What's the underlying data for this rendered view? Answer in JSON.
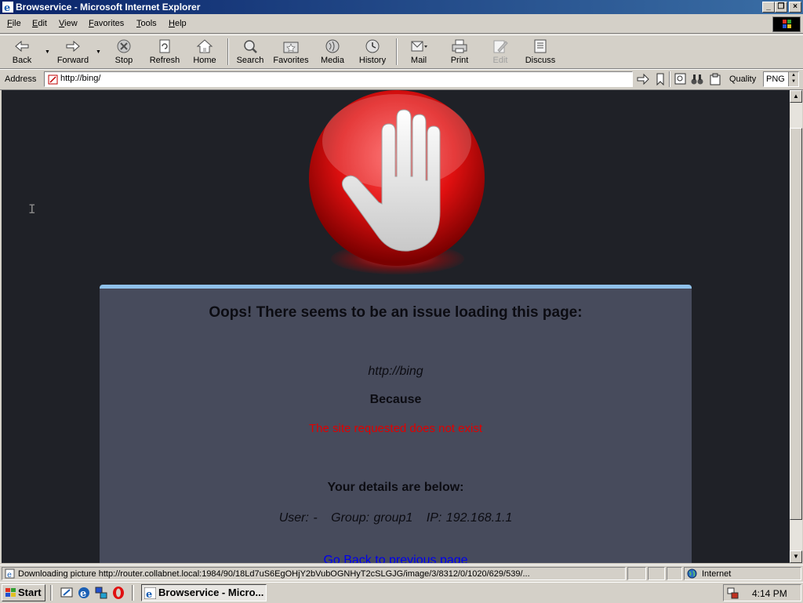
{
  "window": {
    "title": "Browservice - Microsoft Internet Explorer"
  },
  "menu": {
    "items": [
      {
        "accel": "F",
        "rest": "ile"
      },
      {
        "accel": "E",
        "rest": "dit"
      },
      {
        "accel": "V",
        "rest": "iew"
      },
      {
        "accel": "F",
        "rest": "avorites"
      },
      {
        "accel": "T",
        "rest": "ools"
      },
      {
        "accel": "H",
        "rest": "elp"
      }
    ]
  },
  "toolbar": {
    "back": "Back",
    "forward": "Forward",
    "stop": "Stop",
    "refresh": "Refresh",
    "home": "Home",
    "search": "Search",
    "favorites": "Favorites",
    "media": "Media",
    "history": "History",
    "mail": "Mail",
    "print": "Print",
    "edit": "Edit",
    "discuss": "Discuss"
  },
  "address": {
    "label": "Address",
    "url": "http://bing/",
    "quality_label": "Quality",
    "quality_value": "PNG"
  },
  "page": {
    "heading": "Oops! There seems to be an issue loading this page:",
    "url": "http://bing",
    "because": "Because",
    "reason": "The site requested does not exist",
    "details_heading": "Your details are below:",
    "user": "User: -",
    "group": "Group: group1",
    "ip": "IP: 192.168.1.1",
    "back_link": "Go Back to previous page",
    "reason_color": "#e00000",
    "link_color": "#0000ee"
  },
  "status": {
    "text": "Downloading picture http://router.collabnet.local:1984/90/18Ld7uS6EgOHjY2bVubOGNHyT2cSLGJG/image/3/8312/0/1020/629/539/...",
    "zone": "Internet"
  },
  "taskbar": {
    "start": "Start",
    "task": "Browservice - Micro...",
    "clock": "4:14 PM"
  }
}
